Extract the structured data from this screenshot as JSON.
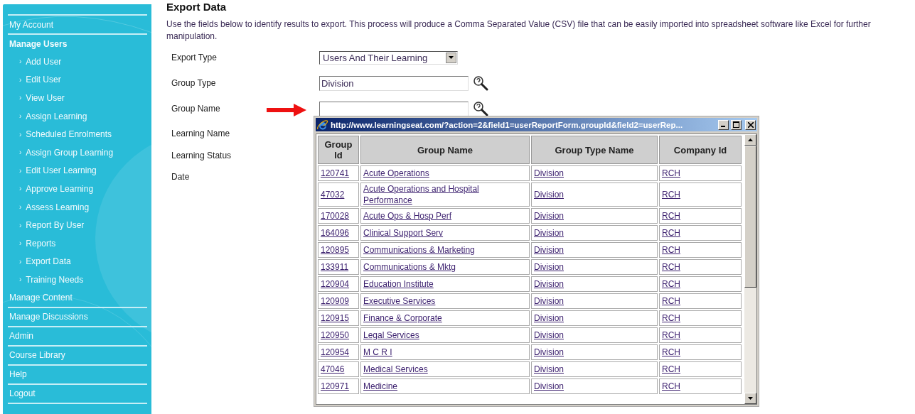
{
  "sidebar": {
    "items": [
      {
        "label": "My Account",
        "kind": "section"
      },
      {
        "label": "Manage Users",
        "kind": "heading"
      },
      {
        "label": "Add User",
        "kind": "sub"
      },
      {
        "label": "Edit User",
        "kind": "sub"
      },
      {
        "label": "View User",
        "kind": "sub"
      },
      {
        "label": "Assign Learning",
        "kind": "sub"
      },
      {
        "label": "Scheduled Enrolments",
        "kind": "sub"
      },
      {
        "label": "Assign Group Learning",
        "kind": "sub"
      },
      {
        "label": "Edit User Learning",
        "kind": "sub"
      },
      {
        "label": "Approve Learning",
        "kind": "sub"
      },
      {
        "label": "Assess Learning",
        "kind": "sub"
      },
      {
        "label": "Report By User",
        "kind": "sub"
      },
      {
        "label": "Reports",
        "kind": "sub"
      },
      {
        "label": "Export Data",
        "kind": "sub"
      },
      {
        "label": "Training Needs",
        "kind": "sub"
      },
      {
        "label": "Manage Content",
        "kind": "section"
      },
      {
        "label": "Manage Discussions",
        "kind": "section"
      },
      {
        "label": "Admin",
        "kind": "section"
      },
      {
        "label": "Course Library",
        "kind": "section"
      },
      {
        "label": "Help",
        "kind": "section"
      },
      {
        "label": "Logout",
        "kind": "section"
      }
    ],
    "bullet": "›"
  },
  "page": {
    "title": "Export Data",
    "description": "Use the fields below to identify results to export. This process will produce a Comma Separated Value (CSV) file that can be easily imported into spreadsheet software like Excel for further manipulation."
  },
  "form": {
    "fields": [
      {
        "label": "Export Type",
        "kind": "select",
        "value": "Users And Their Learning"
      },
      {
        "label": "Group Type",
        "kind": "lookup",
        "value": "Division"
      },
      {
        "label": "Group Name",
        "kind": "lookup",
        "arrow": true
      },
      {
        "label": "Learning Name",
        "kind": "none"
      },
      {
        "label": "Learning Status",
        "kind": "none"
      },
      {
        "label": "Date",
        "kind": "none"
      }
    ]
  },
  "popup": {
    "title": "http://www.learningseat.com/?action=2&field1=userReportForm.groupId&field2=userRep...",
    "table": {
      "columns": [
        "Group Id",
        "Group Name",
        "Group Type Name",
        "Company Id"
      ],
      "rows": [
        [
          "120741",
          "Acute Operations",
          "Division",
          "RCH"
        ],
        [
          "47032",
          "Acute Operations and Hospital Performance",
          "Division",
          "RCH"
        ],
        [
          "170028",
          "Acute Ops & Hosp Perf",
          "Division",
          "RCH"
        ],
        [
          "164096",
          "Clinical Support Serv",
          "Division",
          "RCH"
        ],
        [
          "120895",
          "Communications & Marketing",
          "Division",
          "RCH"
        ],
        [
          "133911",
          "Communications & Mktg",
          "Division",
          "RCH"
        ],
        [
          "120904",
          "Education Institute",
          "Division",
          "RCH"
        ],
        [
          "120909",
          "Executive Services",
          "Division",
          "RCH"
        ],
        [
          "120915",
          "Finance & Corporate",
          "Division",
          "RCH"
        ],
        [
          "120950",
          "Legal Services",
          "Division",
          "RCH"
        ],
        [
          "120954",
          "M C R I",
          "Division",
          "RCH"
        ],
        [
          "47046",
          "Medical Services",
          "Division",
          "RCH"
        ],
        [
          "120971",
          "Medicine",
          "Division",
          "RCH"
        ]
      ]
    }
  }
}
